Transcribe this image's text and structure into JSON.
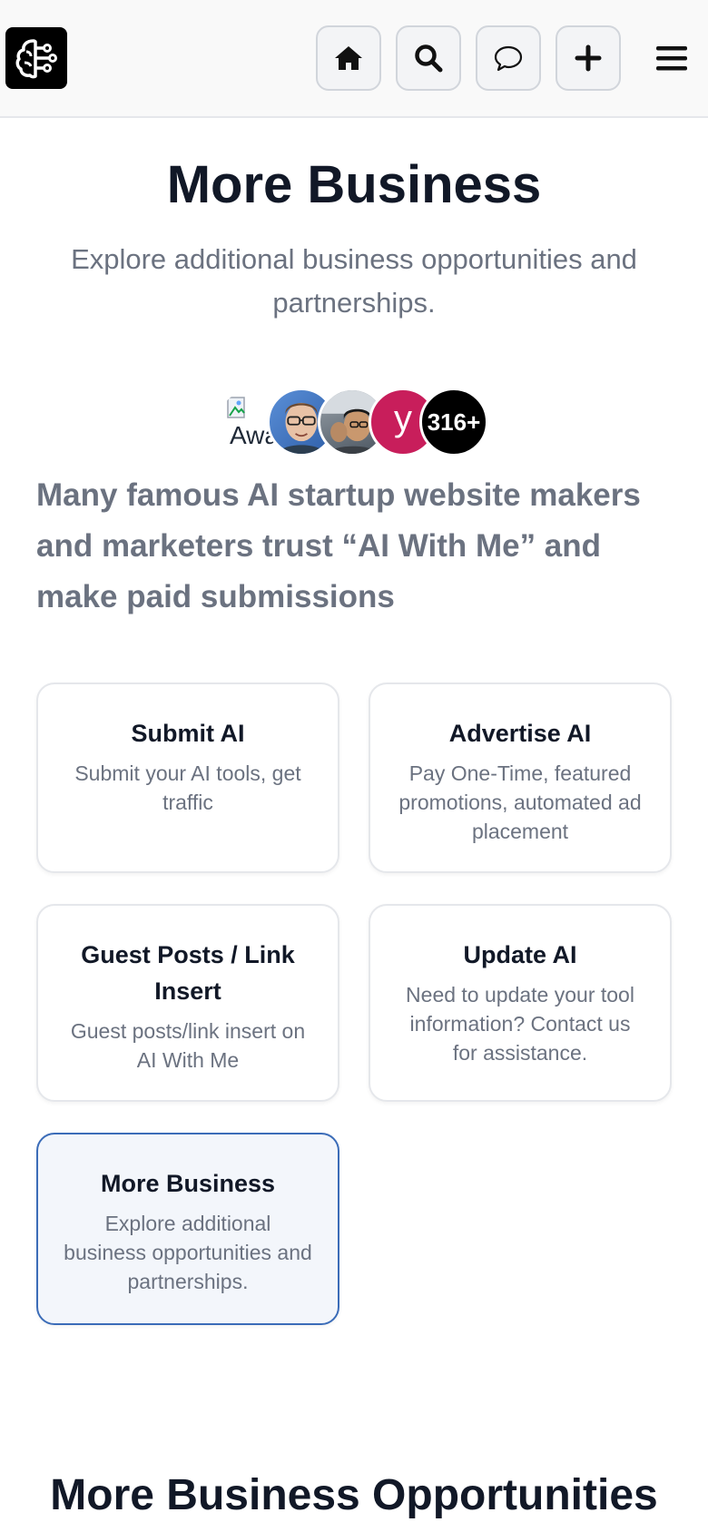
{
  "header": {
    "logo_icon": "brain-circuit-icon",
    "nav": [
      {
        "icon": "home-icon"
      },
      {
        "icon": "search-icon"
      },
      {
        "icon": "chat-bubble-icon"
      },
      {
        "icon": "plus-icon"
      }
    ],
    "menu_icon": "hamburger-menu-icon"
  },
  "hero": {
    "title": "More Business",
    "subtitle": "Explore additional business opportunities and partnerships."
  },
  "social_proof": {
    "avatars": [
      {
        "alt_text": "Awa",
        "type": "broken-image"
      },
      {
        "type": "photo"
      },
      {
        "type": "photo"
      },
      {
        "letter": "y",
        "color": "#c81e5b"
      },
      {
        "count": "316+",
        "color": "#000000"
      }
    ],
    "trust_text": "Many famous AI startup website makers and marketers trust “AI With Me” and make paid submissions"
  },
  "cards": [
    {
      "title": "Submit AI",
      "description": "Submit your AI tools, get traffic"
    },
    {
      "title": "Advertise AI",
      "description": "Pay One-Time, featured promotions, automated ad placement"
    },
    {
      "title": "Guest Posts / Link Insert",
      "description": "Guest posts/link insert on AI With Me"
    },
    {
      "title": "Update AI",
      "description": "Need to update your tool information? Contact us for assistance."
    },
    {
      "title": "More Business",
      "description": "Explore additional business opportunities and partnerships.",
      "active": true
    }
  ],
  "section": {
    "title": "More Business Opportunities"
  },
  "colors": {
    "accent_border": "#3b6cb8",
    "muted_text": "#6b7280"
  }
}
